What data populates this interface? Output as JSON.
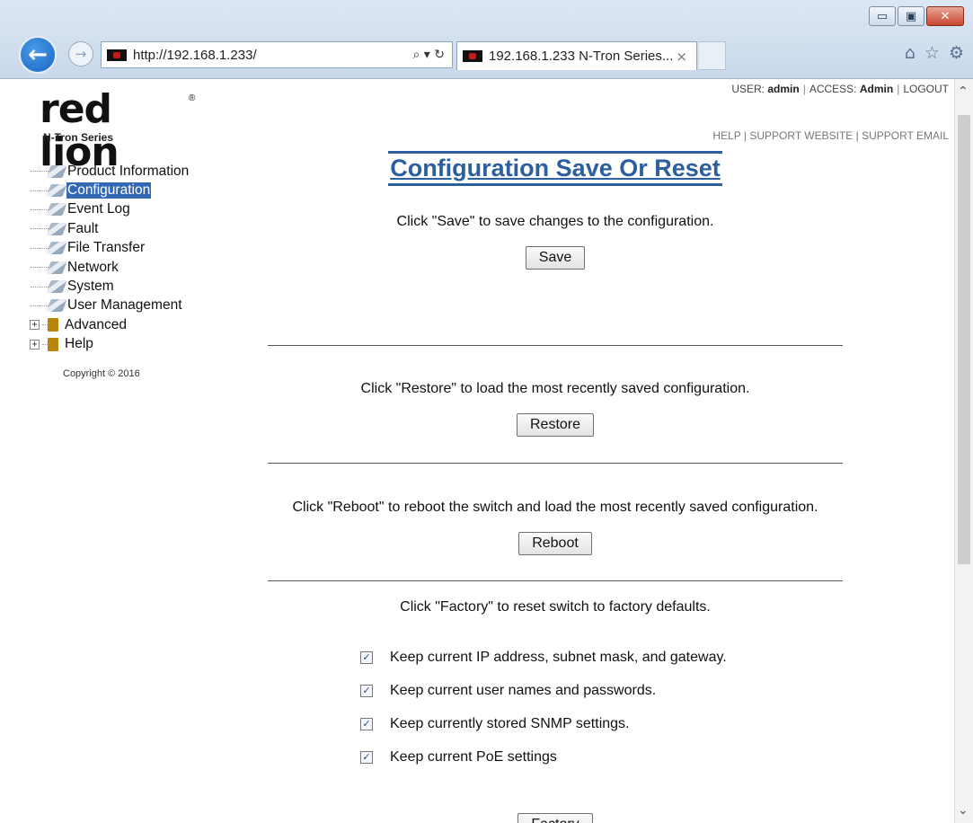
{
  "browser": {
    "address_url": "http://192.168.1.233/",
    "tab_title": "192.168.1.233 N-Tron Series...",
    "search_refresh": "⌕ ▾ ↻",
    "tab_close": "×",
    "window_buttons": {
      "minimize": "▭",
      "maximize": "▣",
      "close": "✕"
    },
    "toolbar_icons": [
      "home-icon",
      "star-icon",
      "gear-icon"
    ]
  },
  "header": {
    "logo_text": "red lion",
    "logo_sub": "N-Tron Series",
    "user_label": "USER:",
    "user": "admin",
    "access_label": "ACCESS:",
    "access": "Admin",
    "logout": "LOGOUT",
    "help_links": {
      "help": "HELP",
      "support_website": "SUPPORT WEBSITE",
      "support_email": "SUPPORT EMAIL"
    }
  },
  "sidebar": {
    "items": [
      {
        "label": "Product Information"
      },
      {
        "label": "Configuration",
        "selected": true
      },
      {
        "label": "Event Log"
      },
      {
        "label": "Fault"
      },
      {
        "label": "File Transfer"
      },
      {
        "label": "Network"
      },
      {
        "label": "System"
      },
      {
        "label": "User Management"
      },
      {
        "label": "Advanced",
        "folder": true
      },
      {
        "label": "Help",
        "folder": true
      }
    ],
    "copyright": "Copyright © 2016"
  },
  "main": {
    "title": "Configuration Save Or Reset",
    "save_text": "Click \"Save\" to save changes to the configuration.",
    "save_button": "Save",
    "restore_text": "Click \"Restore\" to load the most recently saved configuration.",
    "restore_button": "Restore",
    "reboot_text": "Click \"Reboot\" to reboot the switch and load the most recently saved configuration.",
    "reboot_button": "Reboot",
    "factory_text": "Click \"Factory\" to reset switch to factory defaults.",
    "options": [
      {
        "label": "Keep current IP address, subnet mask, and gateway.",
        "checked": true
      },
      {
        "label": "Keep current user names and passwords.",
        "checked": true
      },
      {
        "label": "Keep currently stored SNMP settings.",
        "checked": true
      },
      {
        "label": "Keep current PoE settings",
        "checked": true
      }
    ],
    "factory_button": "Factory"
  }
}
